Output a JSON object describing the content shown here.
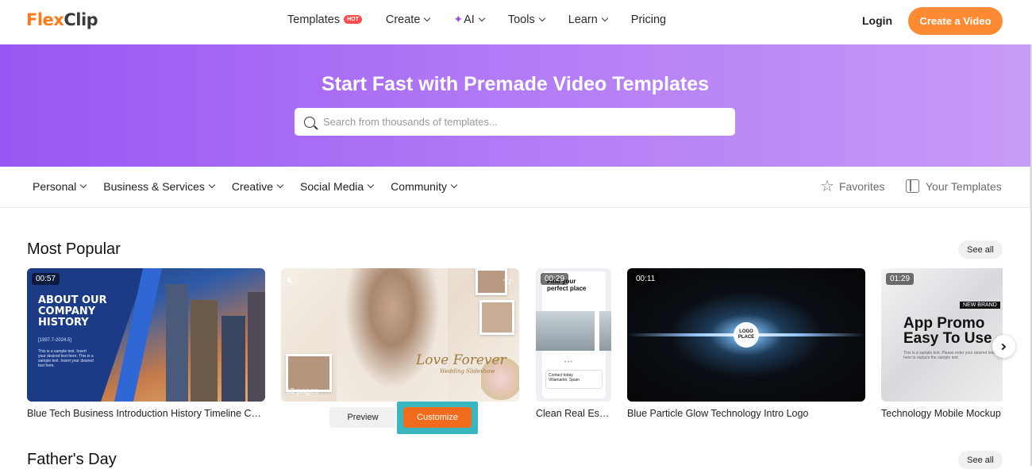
{
  "header": {
    "logo_text_flex": "Flex",
    "logo_text_clip": "Clip",
    "nav": {
      "templates": "Templates",
      "hot_badge": "HOT",
      "create": "Create",
      "ai": "AI",
      "tools": "Tools",
      "learn": "Learn",
      "pricing": "Pricing"
    },
    "login": "Login",
    "create_video": "Create a Video"
  },
  "hero": {
    "title": "Start Fast with Premade Video Templates",
    "search_placeholder": "Search from thousands of templates..."
  },
  "categories": {
    "items": [
      "Personal",
      "Business & Services",
      "Creative",
      "Social Media",
      "Community"
    ],
    "favorites": "Favorites",
    "your_templates": "Your Templates"
  },
  "most_popular": {
    "title": "Most Popular",
    "see_all": "See all",
    "cards": [
      {
        "duration": "00:57",
        "caption": "Blue Tech Business Introduction History Timeline Conf...",
        "thumb_title_1": "ABOUT OUR",
        "thumb_title_2": "COMPANY",
        "thumb_title_3": "HISTORY",
        "thumb_sub": "[1997.7-2024.5]",
        "thumb_small": "This is a sample text. Insert your desired text here. This is a sample text. Insert your desired text here."
      },
      {
        "pages": "13 pages",
        "thumb_title": "Love Forever",
        "thumb_sub": "Wedding Slideshow",
        "preview": "Preview",
        "customize": "Customize"
      },
      {
        "duration": "00:29",
        "caption": "Clean Real Estate...",
        "thumb_title_1": "Find your",
        "thumb_title_2": "perfect place",
        "thumb_loc_1": "Contact today",
        "thumb_loc_2": "Villamartin, Spain"
      },
      {
        "duration": "00:11",
        "caption": "Blue Particle Glow Technology Intro Logo",
        "thumb_logo_1": "LOGO",
        "thumb_logo_2": "PLACE"
      },
      {
        "duration": "01:29",
        "caption": "Technology Mobile Mockup A...",
        "thumb_badge": "NEW BRAND",
        "thumb_title_1": "App Promo",
        "thumb_title_2": "Easy To Use",
        "thumb_small": "This is a sample text. Please enter your desired text here to replace the sample text."
      }
    ]
  },
  "fathers_day": {
    "title": "Father's Day",
    "see_all": "See all"
  },
  "colors": {
    "brand_orange": "#ff8a34",
    "hero_purple": "#9a56f3",
    "customize_highlight": "#39b6bf"
  },
  "icons": {
    "search": "search-icon",
    "favorites": "star-icon",
    "your_templates": "template-icon",
    "next": "chevron-right-icon",
    "mute": "mute-icon"
  }
}
